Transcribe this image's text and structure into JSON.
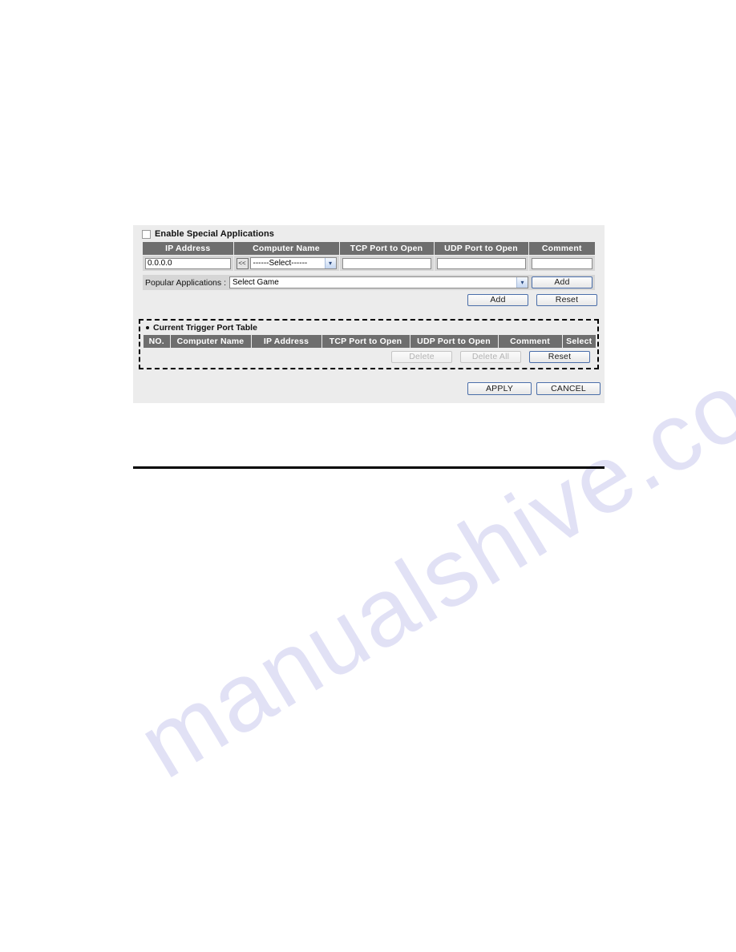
{
  "panel": {
    "enable_checkbox_label": "Enable Special Applications",
    "enable_checked": false
  },
  "special_app_table": {
    "headers": [
      "IP Address",
      "Computer Name",
      "TCP Port to Open",
      "UDP Port to Open",
      "Comment"
    ],
    "row": {
      "ip_address_value": "0.0.0.0",
      "computer_name_button": "<<",
      "computer_name_select_value": "------Select------",
      "tcp_port_value": "",
      "udp_port_value": "",
      "comment_value": ""
    }
  },
  "popular_applications": {
    "label": "Popular Applications  :",
    "select_value": "Select Game",
    "add_button": "Add"
  },
  "form_actions": {
    "add_button": "Add",
    "reset_button": "Reset"
  },
  "trigger_table": {
    "title": "Current Trigger Port Table",
    "headers": [
      "NO.",
      "Computer Name",
      "IP Address",
      "TCP Port to Open",
      "UDP Port to Open",
      "Comment",
      "Select"
    ],
    "rows": [],
    "delete_button": "Delete",
    "delete_all_button": "Delete All",
    "reset_button": "Reset",
    "delete_disabled": true,
    "delete_all_disabled": true
  },
  "page_actions": {
    "apply_button": "APPLY",
    "cancel_button": "CANCEL"
  },
  "watermark": {
    "text": "manualshive.com"
  },
  "colors": {
    "panel_background": "#ececec",
    "header_row": "#6e6e6e",
    "field_row": "#d6d6d6",
    "watermark": "#c9c9ee"
  },
  "icons": {
    "dropdown_arrow": "▾"
  }
}
